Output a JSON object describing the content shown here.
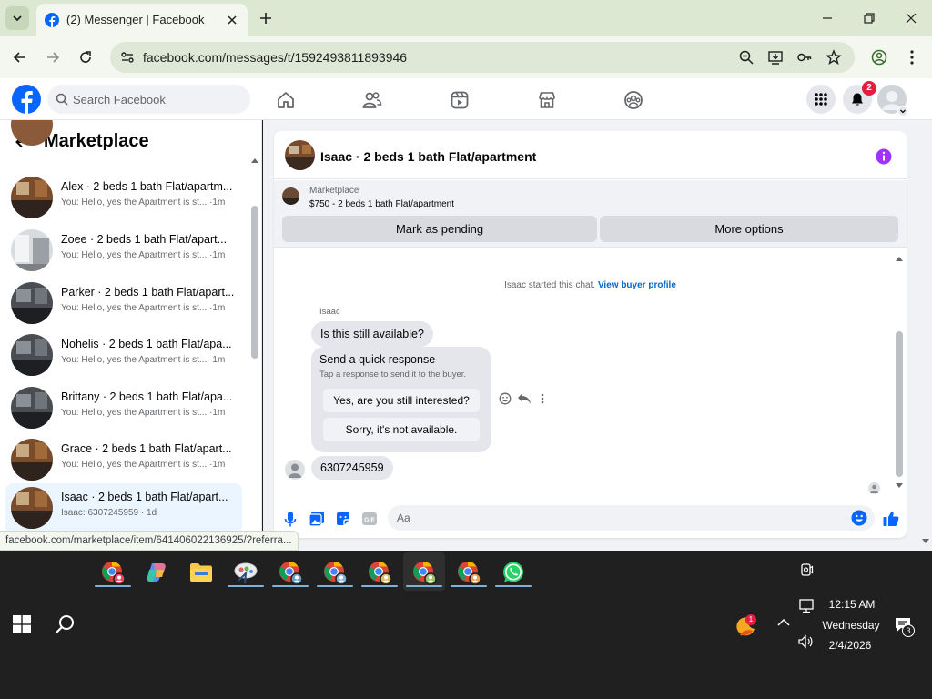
{
  "browser": {
    "tab_title": "(2) Messenger | Facebook",
    "url": "facebook.com/messages/t/1592493811893946"
  },
  "facebook": {
    "search_placeholder": "Search Facebook",
    "notifications_count": "2"
  },
  "sidebar": {
    "title": "Marketplace",
    "conversations": [
      {
        "name": "Alex · 2 beds 1 bath Flat/apartm...",
        "preview": "You: Hello, yes the Apartment is st...",
        "time": "·1m",
        "thumb": "kitchen"
      },
      {
        "name": "Zoee · 2 beds 1 bath Flat/apart...",
        "preview": "You: Hello, yes the Apartment is st...",
        "time": "·1m",
        "thumb": "bright"
      },
      {
        "name": "Parker · 2 beds 1 bath Flat/apart...",
        "preview": "You: Hello, yes the Apartment is st...",
        "time": "·1m",
        "thumb": "grey"
      },
      {
        "name": "Nohelis · 2 beds 1 bath Flat/apa...",
        "preview": "You: Hello, yes the Apartment is st...",
        "time": "·1m",
        "thumb": "grey"
      },
      {
        "name": "Brittany · 2 beds 1 bath Flat/apa...",
        "preview": "You: Hello, yes the Apartment is st...",
        "time": "·1m",
        "thumb": "grey"
      },
      {
        "name": "Grace · 2 beds 1 bath Flat/apart...",
        "preview": "You: Hello, yes the Apartment is st...",
        "time": "·1m",
        "thumb": "kitchen"
      },
      {
        "name": "Isaac · 2 beds 1 bath Flat/apart...",
        "preview": "Isaac: 6307245959",
        "time": "· 1d",
        "thumb": "kitchen"
      }
    ]
  },
  "chat": {
    "title": "Isaac · 2 beds 1 bath Flat/apartment",
    "listing_label": "Marketplace",
    "listing_price": "$750 - 2 beds 1 bath Flat/apartment",
    "mark_pending": "Mark as pending",
    "more_options": "More options",
    "system_text": "Isaac started this chat.",
    "system_link": "View buyer profile",
    "sender": "Isaac",
    "message1": "Is this still available?",
    "quick_title": "Send a quick response",
    "quick_sub": "Tap a response to send it to the buyer.",
    "quick_option1": "Yes, are you still interested?",
    "quick_option2": "Sorry, it's not available.",
    "message2": "6307245959",
    "input_placeholder": "Aa"
  },
  "status_bar_url": "facebook.com/marketplace/item/641406022136925/?referra...",
  "taskbar": {
    "time": "12:15 AM",
    "day": "Wednesday",
    "date": "2/4/2026",
    "notifications": "3",
    "weather_badge": "1"
  },
  "colors": {
    "fb_blue": "#0866ff",
    "chrome_green": "#dce8d1",
    "messenger_purple": "#a033ff"
  }
}
